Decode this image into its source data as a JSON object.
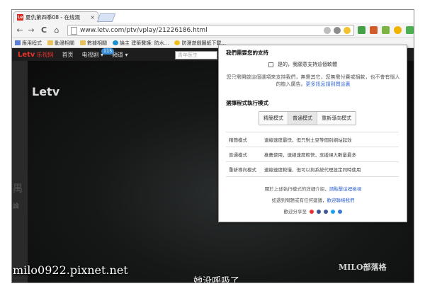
{
  "browser": {
    "tab_title": "夏仇第四季08 - 在线观",
    "tab_favicon": "Le",
    "url": "www.letv.com/ptv/vplay/21226186.html",
    "nav": {
      "back": "←",
      "forward": "→",
      "reload": "C",
      "home": "⌂"
    },
    "bookmarks": [
      "應用程式",
      "動漫相關",
      "數據相關",
      "論主 建築醫護: 防水...",
      "防漫遊戲圖紙下載..."
    ]
  },
  "site": {
    "logo": "Letv",
    "logo_sub": "乐视网",
    "nav": [
      "首页",
      "电视剧 ▾",
      "頻道 ▾"
    ],
    "badge": "115",
    "search_placeholder": "青年医生"
  },
  "video": {
    "logo": "Letv",
    "left_chars": [
      "禺",
      "論"
    ],
    "subtitle": "她没呼吸了"
  },
  "popup": {
    "support_heading": "我們需要您的支持",
    "support_checkbox": "是的，我願意支持這個軟體",
    "support_para": "您只需開啟這個選項來支持我們，無需其它，您無需付費或捐款，也不會有惱人的植入廣告。",
    "support_link": "更多訊息請到問這裏",
    "mode_heading": "選擇程式執行模式",
    "modes": [
      "精簡模式",
      "普通模式",
      "重新導向模式"
    ],
    "active_mode": "普通模式",
    "mode_rows": [
      {
        "name": "精簡模式",
        "desc": "連線速度最快，但只對土豆等個別網站起效"
      },
      {
        "name": "普通模式",
        "desc": "推薦使用，連線速度較快，支援絕大數量最多"
      },
      {
        "name": "重新導向模式",
        "desc": "連線速度較慢，但可以與系統代理設定同時使用"
      }
    ],
    "more_info": "關於上述執行模式的詳細介紹，",
    "more_info_link": "請點擊這裡檢視",
    "contact": "如遇到問題或有任何建議，",
    "contact_link": "歡迎聯絡我們",
    "share": "歡迎分享至"
  },
  "watermark": {
    "left": "milo0922.pixnet.net",
    "right": "MILO部落格"
  }
}
